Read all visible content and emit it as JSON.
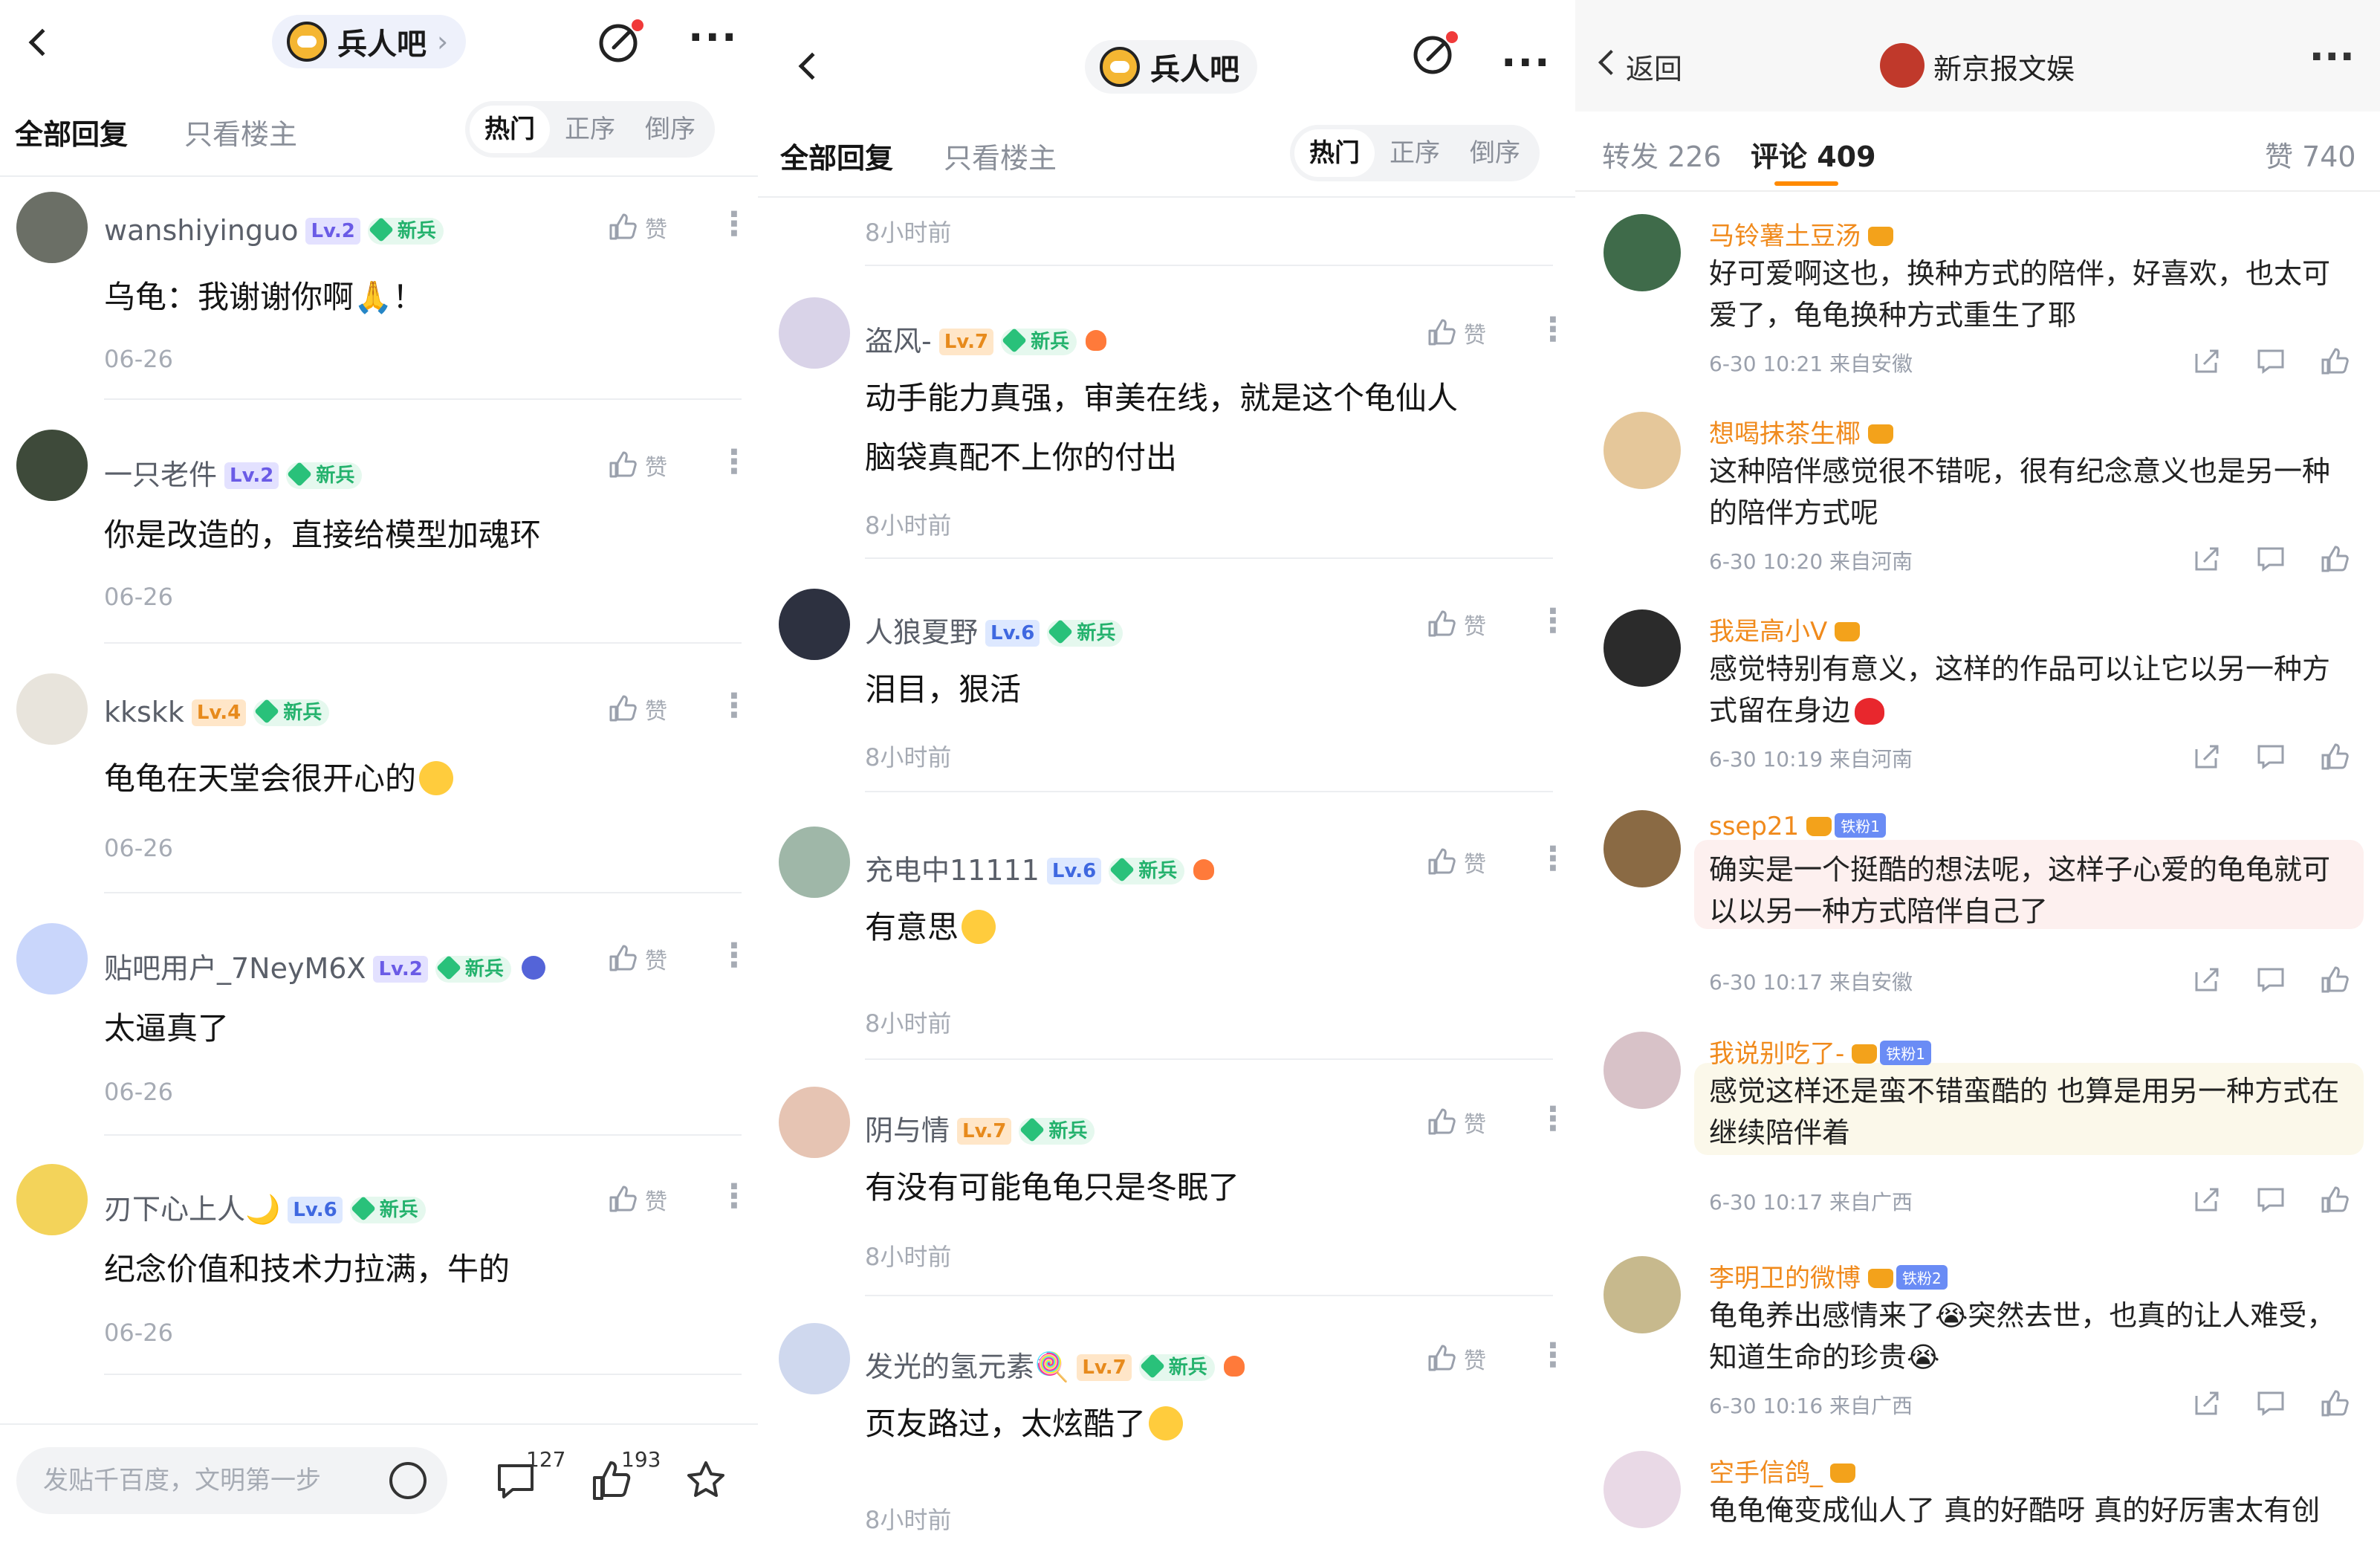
{
  "panel1": {
    "forum_name": "兵人吧",
    "chevron": "›",
    "tabs": {
      "all": "全部回复",
      "owner": "只看楼主"
    },
    "sort": {
      "hot": "热门",
      "asc": "正序",
      "desc": "倒序"
    },
    "like_label": "赞",
    "level_badge": "新兵",
    "comments": [
      {
        "name": "wanshiyinguo",
        "lv": "Lv.2",
        "lv_color": "purple",
        "text": "乌龟：我谢谢你啊🙏！",
        "date": "06-26"
      },
      {
        "name": "一只老件",
        "lv": "Lv.2",
        "lv_color": "purple",
        "text": "你是改造的，直接给模型加魂环",
        "date": "06-26"
      },
      {
        "name": "kkskk",
        "lv": "Lv.4",
        "lv_color": "orange",
        "text": "龟龟在天堂会很开心的",
        "date": "06-26"
      },
      {
        "name": "贴吧用户_7NeyM6X",
        "lv": "Lv.2",
        "lv_color": "purple",
        "text": "太逼真了",
        "date": "06-26"
      },
      {
        "name": "刃下心上人🌙",
        "lv": "Lv.6",
        "lv_color": "blue",
        "text": "纪念价值和技术力拉满，牛的",
        "date": "06-26"
      }
    ],
    "bottom": {
      "placeholder": "发贴千百度，文明第一步",
      "comment_count": "127",
      "like_count": "193"
    }
  },
  "panel2": {
    "forum_name": "兵人吧",
    "tabs": {
      "all": "全部回复",
      "owner": "只看楼主"
    },
    "sort": {
      "hot": "热门",
      "asc": "正序",
      "desc": "倒序"
    },
    "like_label": "赞",
    "level_badge": "新兵",
    "top_time": "8小时前",
    "comments": [
      {
        "name": "盗风-",
        "lv": "Lv.7",
        "lv_color": "orange",
        "text_lines": [
          "动手能力真强，审美在线，就是这个龟仙人",
          "脑袋真配不上你的付出"
        ],
        "time": "8小时前"
      },
      {
        "name": "人狼夏野",
        "lv": "Lv.6",
        "lv_color": "blue",
        "text_lines": [
          "泪目，狠活"
        ],
        "time": "8小时前"
      },
      {
        "name": "充电中11111",
        "lv": "Lv.6",
        "lv_color": "blue",
        "text_lines": [
          "有意思"
        ],
        "time": "8小时前"
      },
      {
        "name": "阴与情",
        "lv": "Lv.7",
        "lv_color": "orange",
        "text_lines": [
          "有没有可能龟龟只是冬眠了"
        ],
        "time": "8小时前"
      },
      {
        "name": "发光的氢元素🍭",
        "lv": "Lv.7",
        "lv_color": "orange",
        "text_lines": [
          "页友路过，太炫酷了"
        ],
        "time": "8小时前"
      }
    ]
  },
  "panel3": {
    "back_label": "返回",
    "account": "新京报文娱",
    "tabs": {
      "repost": "转发 226",
      "comments": "评论 409",
      "likes": "赞 740"
    },
    "accent": "#ff8a00",
    "comments": [
      {
        "name": "马铃薯土豆汤",
        "text": "好可爱啊这也，换种方式的陪伴，好喜欢，也太可爱了，龟龟换种方式重生了耶",
        "meta": "6-30 10:21  来自安徽"
      },
      {
        "name": "想喝抹茶生椰",
        "text": "这种陪伴感觉很不错呢，很有纪念意义也是另一种的陪伴方式呢",
        "meta": "6-30 10:20  来自河南"
      },
      {
        "name": "我是高小V",
        "text": "感觉特别有意义，这样的作品可以让它以另一种方式留在身边",
        "meta": "6-30 10:19  来自河南"
      },
      {
        "name": "ssep21",
        "fan": "铁粉1",
        "text": "确实是一个挺酷的想法呢，这样子心爱的龟龟就可以以另一种方式陪伴自己了",
        "meta": "6-30 10:17  来自安徽"
      },
      {
        "name": "我说别吃了-",
        "fan": "铁粉1",
        "text": "感觉这样还是蛮不错蛮酷的 也算是用另一种方式在继续陪伴着",
        "meta": "6-30 10:17  来自广西"
      },
      {
        "name": "李明卫的微博",
        "fan": "铁粉2",
        "text": "龟龟养出感情来了😭突然去世，也真的让人难受，知道生命的珍贵😭",
        "meta": "6-30 10:16  来自广西"
      },
      {
        "name": "空手信鸽_",
        "text": "龟龟俺变成仙人了 真的好酷呀 真的好厉害太有创",
        "meta": ""
      }
    ]
  }
}
